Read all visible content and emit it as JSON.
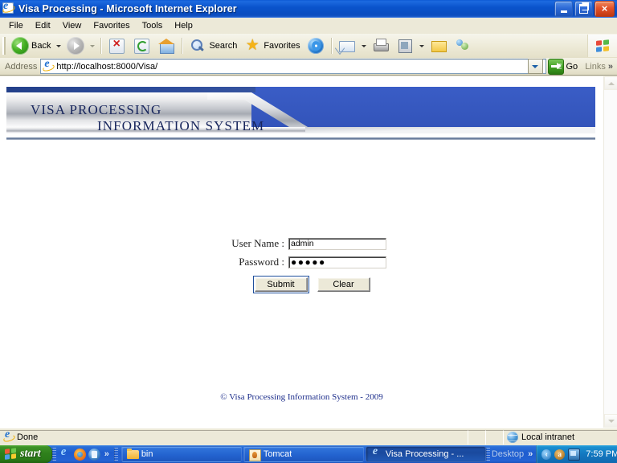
{
  "window": {
    "title": "Visa Processing - Microsoft Internet Explorer",
    "icon": "ie-icon",
    "buttons": {
      "minimize": "_",
      "maximize": "❐",
      "close": "×"
    }
  },
  "menu": {
    "items": [
      {
        "label": "File"
      },
      {
        "label": "Edit"
      },
      {
        "label": "View"
      },
      {
        "label": "Favorites"
      },
      {
        "label": "Tools"
      },
      {
        "label": "Help"
      }
    ]
  },
  "toolbar": {
    "back_label": "Back",
    "search_label": "Search",
    "favorites_label": "Favorites",
    "icons": [
      "back-icon",
      "forward-icon",
      "stop-icon",
      "refresh-icon",
      "home-icon",
      "search-icon",
      "favorites-star-icon",
      "media-icon",
      "mail-icon",
      "print-icon",
      "edit-icon",
      "notes-icon",
      "messenger-icon"
    ],
    "windows_logo": "windows-flag-logo"
  },
  "address_bar": {
    "label": "Address",
    "url": "http://localhost:8000/Visa/",
    "go_label": "Go",
    "links_label": "Links",
    "overflow_chevron": "»"
  },
  "page": {
    "banner": {
      "line1": "VISA PROCESSING",
      "line2": "INFORMATION SYSTEM",
      "blue": "#3659c0",
      "navy": "#1f3f86",
      "silver_light": "#fdfdfd",
      "silver_dark": "#9ea3ac",
      "rule_color": "#5f7394"
    },
    "login": {
      "username_label": "User Name :",
      "username_value": "admin",
      "username_placeholder": "",
      "password_label": "Password :",
      "password_value": "●●●●●",
      "password_placeholder": "",
      "submit_label": "Submit",
      "clear_label": "Clear"
    },
    "footer": "© Visa Processing Information System - 2009",
    "footer_color": "#1e2f8c"
  },
  "status_bar": {
    "message": "Done",
    "zone": "Local intranet",
    "zone_icon": "globe-icon",
    "page_icon": "ie-icon"
  },
  "taskbar": {
    "start_label": "start",
    "quick_launch": [
      {
        "name": "ie-icon"
      },
      {
        "name": "firefox-icon"
      },
      {
        "name": "app-icon"
      }
    ],
    "quick_launch_chevron": "»",
    "tasks": [
      {
        "label": "bin",
        "icon": "folder-icon",
        "active": false
      },
      {
        "label": "Tomcat",
        "icon": "tomcat-icon",
        "active": false
      },
      {
        "label": "Visa Processing - ...",
        "icon": "ie-icon",
        "active": true
      }
    ],
    "deskbar_label": "Desktop",
    "deskbar_chevron": "»",
    "tray_icons": [
      "network-icon",
      "acrobat-icon",
      "display-icon"
    ],
    "clock": "7:59 PM"
  }
}
